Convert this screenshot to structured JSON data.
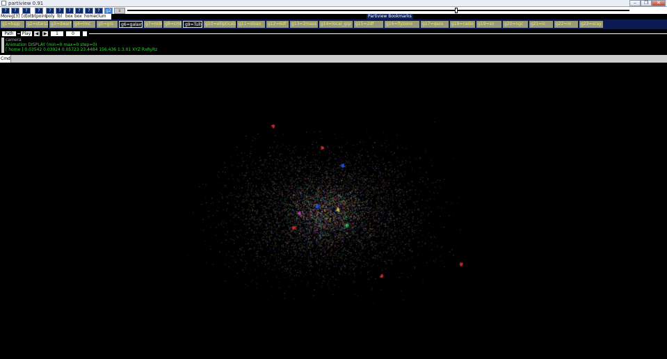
{
  "window": {
    "title": "partiview 0.91"
  },
  "toolbar": {
    "buttons": [
      "?",
      "?",
      "?",
      "?",
      "?",
      "?",
      "?",
      "?",
      "?",
      "?",
      "g2",
      "s"
    ],
    "selected_index": 10,
    "slider_label": "intt"
  },
  "menu": {
    "items": [
      "More",
      "g[3]",
      "[d]otbt",
      "point",
      "poly",
      "lbl",
      "box",
      "box",
      "home",
      "clum"
    ]
  },
  "bookmarks": {
    "title": "Partiview Bookmarks",
    "items": [
      "g1=hipp",
      "g2=stars2",
      "g3=dwarf",
      "g4=lmc",
      "g5=grs",
      "g6=galaxy",
      "g7=milky",
      "g8=cmb",
      "g9=Tully",
      "g10=ellipticals",
      "g11=sloan",
      "g12=6df",
      "g13=2mass",
      "g14=local_grp",
      "g15=2df",
      "g16=flyzone",
      "g17=qsos",
      "g18=radio",
      "g19=sn",
      "g20=ngc",
      "g21=ic",
      "g22=m",
      "g23=xray"
    ],
    "dark_items": [
      5,
      8
    ]
  },
  "controls": {
    "path_label": "Path",
    "play_label": "Play",
    "frame_value": "1",
    "step_value": "0"
  },
  "info": {
    "line1": "camera",
    "line2": "Animation DISPLAY (min=0 max=0 step=0)",
    "line3": "[ home ]  0.03542  0.03924  0.05723   23.4484   156.436  1:3.01   XYZ RxRyRz"
  },
  "cmd": {
    "label": "Cmd"
  },
  "colors": {
    "navy": "#0a1a55",
    "bookmark_bg": "#9a9a78",
    "bookmark_text": "#e8e866",
    "info_green": "#38d038",
    "viewport_bg": "#000000"
  },
  "icons": {
    "app": "window-app-icon",
    "minimize": "minimize-icon",
    "restore": "restore-icon",
    "close": "close-icon"
  }
}
